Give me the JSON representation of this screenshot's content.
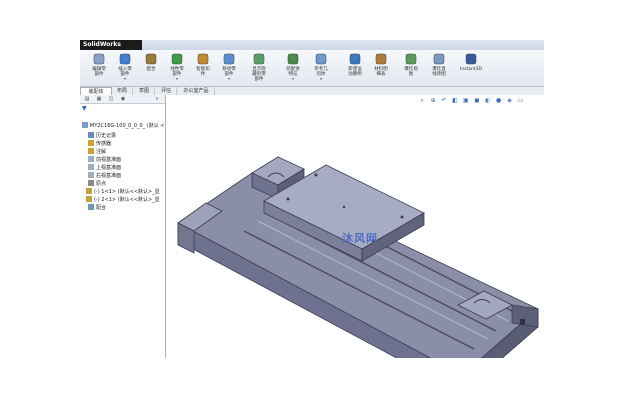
{
  "app": {
    "title": "SolidWorks",
    "accent": "#1b1b1b"
  },
  "ribbon": {
    "buttons": [
      {
        "label": "编辑零\n部件",
        "icon": "edit-part-icon",
        "dd": ""
      },
      {
        "label": "插入零\n部件",
        "icon": "insert-part-icon",
        "dd": "▾"
      },
      {
        "label": "配合",
        "icon": "mate-icon",
        "dd": ""
      },
      {
        "label": "线性零\n部件",
        "icon": "linear-pattern-icon",
        "dd": "▾"
      },
      {
        "label": "智能扣\n件",
        "icon": "smart-fastener-icon",
        "dd": ""
      },
      {
        "label": "移动零\n部件",
        "icon": "move-component-icon",
        "dd": "▾"
      },
      {
        "label": "显示隐\n藏的零\n部件",
        "icon": "show-hidden-icon",
        "dd": ""
      },
      {
        "label": "装配体\n特征",
        "icon": "assembly-feature-icon",
        "dd": "▾"
      },
      {
        "label": "参考几\n何体",
        "icon": "reference-geometry-icon",
        "dd": "▾"
      },
      {
        "label": "新建运\n动算例",
        "icon": "motion-study-icon",
        "dd": ""
      },
      {
        "label": "材料明\n细表",
        "icon": "bom-icon",
        "dd": ""
      },
      {
        "label": "爆炸视\n图",
        "icon": "explode-view-icon",
        "dd": ""
      },
      {
        "label": "爆炸直\n线草图",
        "icon": "explode-line-icon",
        "dd": ""
      },
      {
        "label": "Instant3D",
        "icon": "instant3d-icon",
        "dd": ""
      }
    ]
  },
  "tabs": [
    "装配体",
    "布局",
    "草图",
    "评估",
    "办公室产品"
  ],
  "tree": {
    "root": "MY2C16G-100_0_0_0_ (默认 <",
    "items": [
      "历史记录",
      "传感器",
      "注解",
      "前视基准面",
      "上视基准面",
      "右视基准面",
      "原点",
      "(-) 1<1> (默认<<默认>_显",
      "(-) 2<1> (默认<<默认>_显",
      "配合"
    ]
  },
  "watermark": "沐风网"
}
